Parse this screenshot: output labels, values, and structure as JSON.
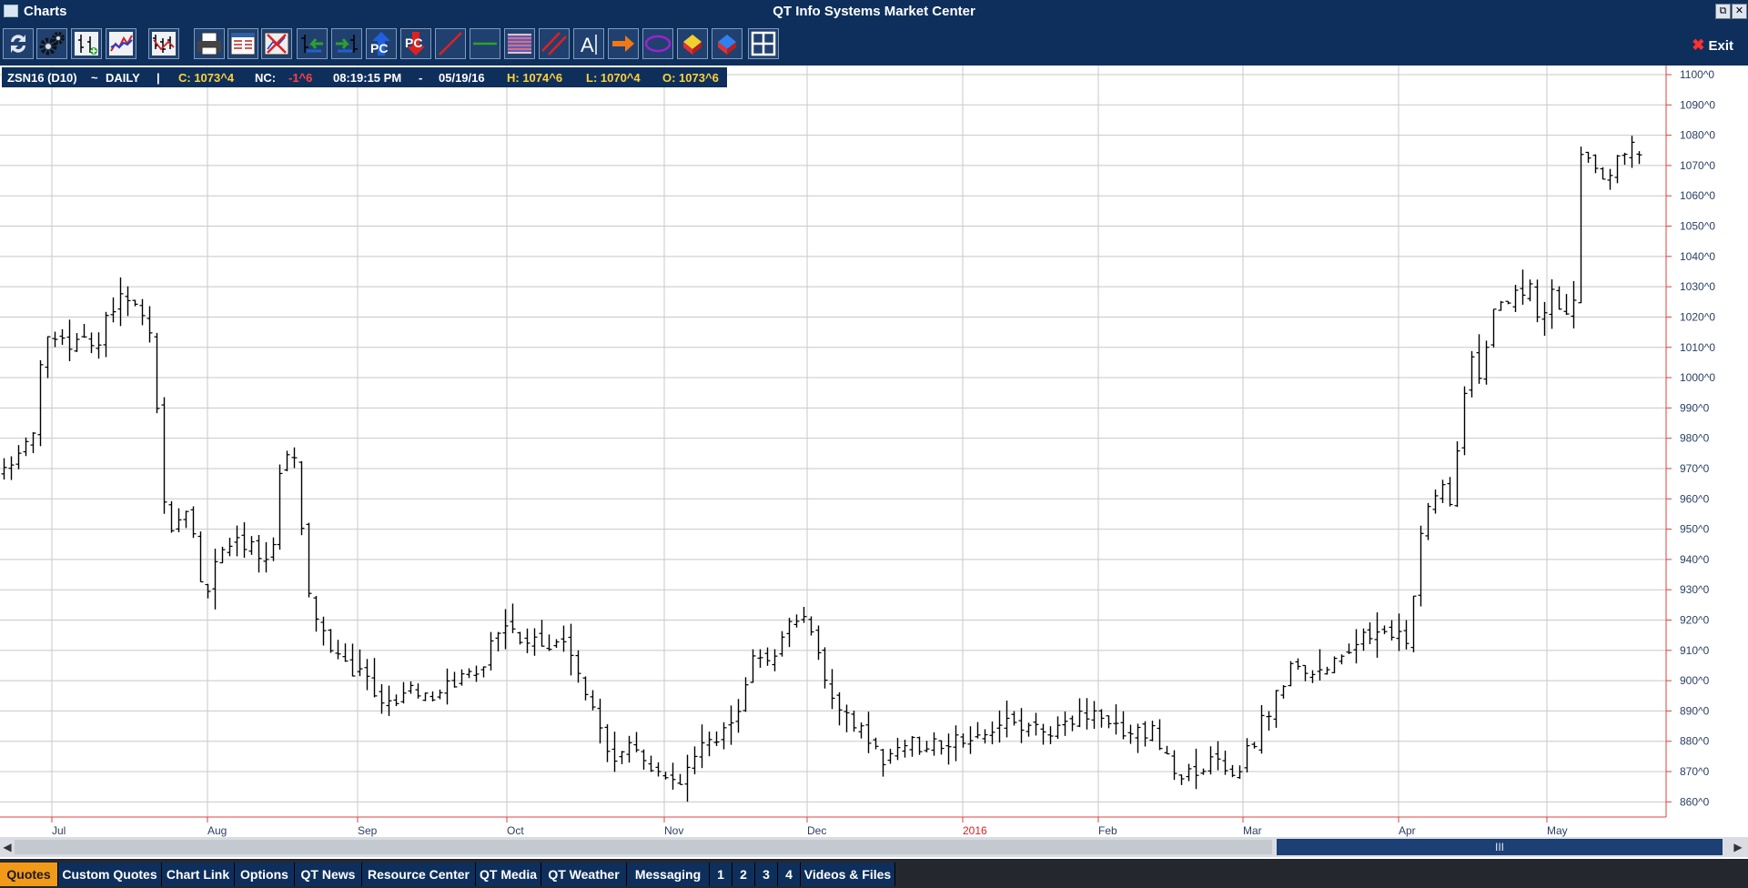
{
  "window": {
    "title": "Charts",
    "app_title": "QT Info Systems Market Center",
    "restore_symbol": "⧉",
    "close_symbol": "✕"
  },
  "toolbar": {
    "exit_label": "Exit",
    "exit_symbol": "✖",
    "buttons": [
      {
        "name": "refresh-icon"
      },
      {
        "name": "settings-gears-icon"
      },
      {
        "name": "add-study-icon"
      },
      {
        "name": "chart-type-icon"
      },
      {
        "name": "bar-chart-icon"
      },
      {
        "name": "print-icon"
      },
      {
        "name": "data-window-icon"
      },
      {
        "name": "clear-chart-icon"
      },
      {
        "name": "scroll-left-icon"
      },
      {
        "name": "scroll-right-icon"
      },
      {
        "name": "pc-up-icon"
      },
      {
        "name": "pc-down-icon"
      },
      {
        "name": "trendline-icon"
      },
      {
        "name": "horizontal-line-icon"
      },
      {
        "name": "fibonacci-icon"
      },
      {
        "name": "parallel-lines-icon"
      },
      {
        "name": "text-tool-icon"
      },
      {
        "name": "arrow-tool-icon"
      },
      {
        "name": "ellipse-tool-icon"
      },
      {
        "name": "eraser-icon"
      },
      {
        "name": "eraser-all-icon"
      },
      {
        "name": "grid-layout-icon"
      }
    ],
    "pc_label": "PC",
    "text_label": "A"
  },
  "quote": {
    "symbol": "ZSN16 (D10)",
    "tilde": "~",
    "period": "DAILY",
    "sep": "|",
    "close": "C: 1073^4",
    "nc_label": "NC:",
    "nc_value": "-1^6",
    "time": "08:19:15 PM",
    "dash": "-",
    "date": "05/19/16",
    "high": "H: 1074^6",
    "low": "L: 1070^4",
    "open": "O: 1073^6"
  },
  "chart_data": {
    "type": "ohlc-bar",
    "ylim": [
      855,
      1103
    ],
    "yticks": [
      "1100^0",
      "1090^0",
      "1080^0",
      "1070^0",
      "1060^0",
      "1050^0",
      "1040^0",
      "1030^0",
      "1020^0",
      "1010^0",
      "1000^0",
      "990^0",
      "980^0",
      "970^0",
      "960^0",
      "950^0",
      "940^0",
      "930^0",
      "920^0",
      "910^0",
      "900^0",
      "890^0",
      "880^0",
      "870^0",
      "860^0"
    ],
    "months": [
      "Jul",
      "Aug",
      "Sep",
      "Oct",
      "Nov",
      "Dec",
      "2016",
      "Feb",
      "Mar",
      "Apr",
      "May"
    ],
    "highlight_month": "2016",
    "path": [
      [
        0,
        968
      ],
      [
        10,
        985
      ],
      [
        12,
        1012
      ],
      [
        30,
        1012
      ],
      [
        36,
        1027
      ],
      [
        46,
        1018
      ],
      [
        52,
        945
      ],
      [
        58,
        955
      ],
      [
        64,
        928
      ],
      [
        70,
        945
      ],
      [
        86,
        942
      ],
      [
        88,
        970
      ],
      [
        92,
        975
      ],
      [
        98,
        920
      ],
      [
        108,
        908
      ],
      [
        116,
        898
      ],
      [
        120,
        894
      ],
      [
        126,
        890
      ],
      [
        128,
        900
      ],
      [
        136,
        893
      ],
      [
        146,
        902
      ],
      [
        152,
        905
      ],
      [
        160,
        922
      ],
      [
        166,
        912
      ],
      [
        176,
        912
      ],
      [
        180,
        910
      ],
      [
        186,
        895
      ],
      [
        192,
        878
      ],
      [
        196,
        875
      ],
      [
        200,
        878
      ],
      [
        206,
        870
      ],
      [
        212,
        870
      ],
      [
        216,
        868
      ],
      [
        220,
        875
      ],
      [
        226,
        880
      ],
      [
        232,
        888
      ],
      [
        238,
        908
      ],
      [
        244,
        906
      ],
      [
        250,
        922
      ],
      [
        256,
        918
      ],
      [
        262,
        898
      ],
      [
        270,
        888
      ],
      [
        276,
        876
      ],
      [
        280,
        875
      ],
      [
        286,
        880
      ],
      [
        290,
        878
      ],
      [
        300,
        880
      ],
      [
        316,
        885
      ],
      [
        326,
        885
      ],
      [
        332,
        880
      ],
      [
        336,
        887
      ],
      [
        344,
        888
      ],
      [
        354,
        885
      ],
      [
        366,
        882
      ],
      [
        372,
        872
      ],
      [
        378,
        868
      ],
      [
        386,
        874
      ],
      [
        390,
        868
      ],
      [
        396,
        878
      ],
      [
        404,
        895
      ],
      [
        410,
        906
      ],
      [
        418,
        902
      ],
      [
        428,
        910
      ],
      [
        436,
        918
      ],
      [
        440,
        918
      ],
      [
        446,
        912
      ],
      [
        448,
        925
      ],
      [
        452,
        958
      ],
      [
        458,
        968
      ],
      [
        460,
        960
      ],
      [
        464,
        986
      ],
      [
        466,
        1010
      ],
      [
        470,
        998
      ],
      [
        474,
        1026
      ],
      [
        478,
        1023
      ],
      [
        482,
        1028
      ],
      [
        486,
        1030
      ],
      [
        488,
        1015
      ],
      [
        490,
        1022
      ],
      [
        492,
        1030
      ],
      [
        495,
        1020
      ],
      [
        499,
        1018
      ],
      [
        500,
        1050
      ],
      [
        502,
        1080
      ],
      [
        506,
        1070
      ],
      [
        510,
        1066
      ],
      [
        514,
        1075
      ],
      [
        520,
        1075
      ]
    ],
    "n_bars": 226,
    "last_bar": {
      "open": 1073.75,
      "high": 1074.75,
      "low": 1070.5,
      "close": 1073.5
    }
  },
  "scrollbar": {
    "left_arrow": "◀",
    "right_arrow": "▶",
    "thumb_label": "III"
  },
  "tabs": [
    {
      "label": "Quotes",
      "active": true
    },
    {
      "label": "Custom Quotes"
    },
    {
      "label": "Chart Link"
    },
    {
      "label": "Options"
    },
    {
      "label": "QT News"
    },
    {
      "label": "Resource Center"
    },
    {
      "label": "QT Media"
    },
    {
      "label": "QT Weather"
    },
    {
      "label": "Messaging"
    },
    {
      "label": "1"
    },
    {
      "label": "2"
    },
    {
      "label": "3"
    },
    {
      "label": "4"
    },
    {
      "label": "Videos & Files"
    }
  ],
  "colors": {
    "navy": "#0e2f5b",
    "yellow": "#ffd23a",
    "red": "#ff4040",
    "orange_tab": "#f19a1a",
    "axis_line": "#e04040",
    "grid": "#c8c8c8",
    "bar": "#000000",
    "label": "#2a3f66"
  }
}
